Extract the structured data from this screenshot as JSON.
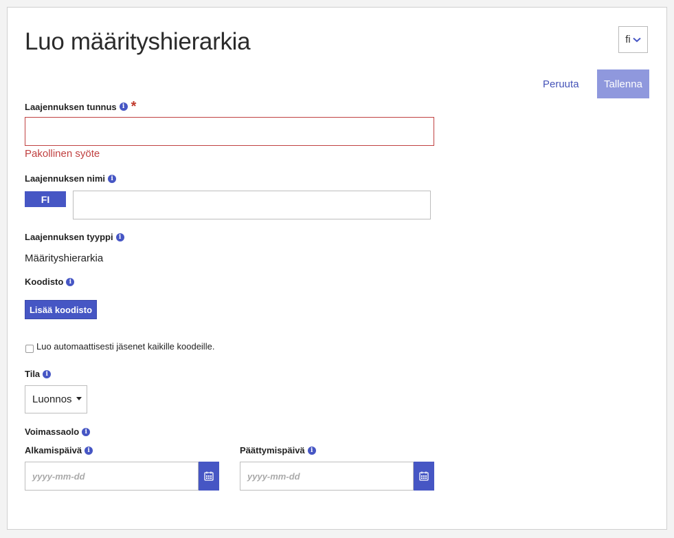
{
  "header": {
    "title": "Luo määrityshierarkia",
    "language": "fi"
  },
  "actions": {
    "cancel_label": "Peruuta",
    "save_label": "Tallenna"
  },
  "fields": {
    "id": {
      "label": "Laajennuksen tunnus",
      "value": "",
      "error": "Pakollinen syöte"
    },
    "name": {
      "label": "Laajennuksen nimi",
      "language_tag": "FI",
      "value": ""
    },
    "type": {
      "label": "Laajennuksen tyyppi",
      "value": "Määrityshierarkia"
    },
    "codelist": {
      "label": "Koodisto",
      "add_button": "Lisää koodisto"
    },
    "auto_members": {
      "label": "Luo automaattisesti jäsenet kaikille koodeille.",
      "checked": false
    },
    "status": {
      "label": "Tila",
      "selected": "Luonnos"
    },
    "validity": {
      "label": "Voimassaolo",
      "start": {
        "label": "Alkamispäivä",
        "placeholder": "yyyy-mm-dd"
      },
      "end": {
        "label": "Päättymispäivä",
        "placeholder": "yyyy-mm-dd"
      }
    }
  },
  "icons": {
    "info": "info-icon",
    "calendar": "calendar-icon",
    "chevron": "chevron-down-icon"
  },
  "colors": {
    "primary": "#4656c4",
    "primary_disabled": "#8f98dd",
    "error": "#c04040"
  }
}
